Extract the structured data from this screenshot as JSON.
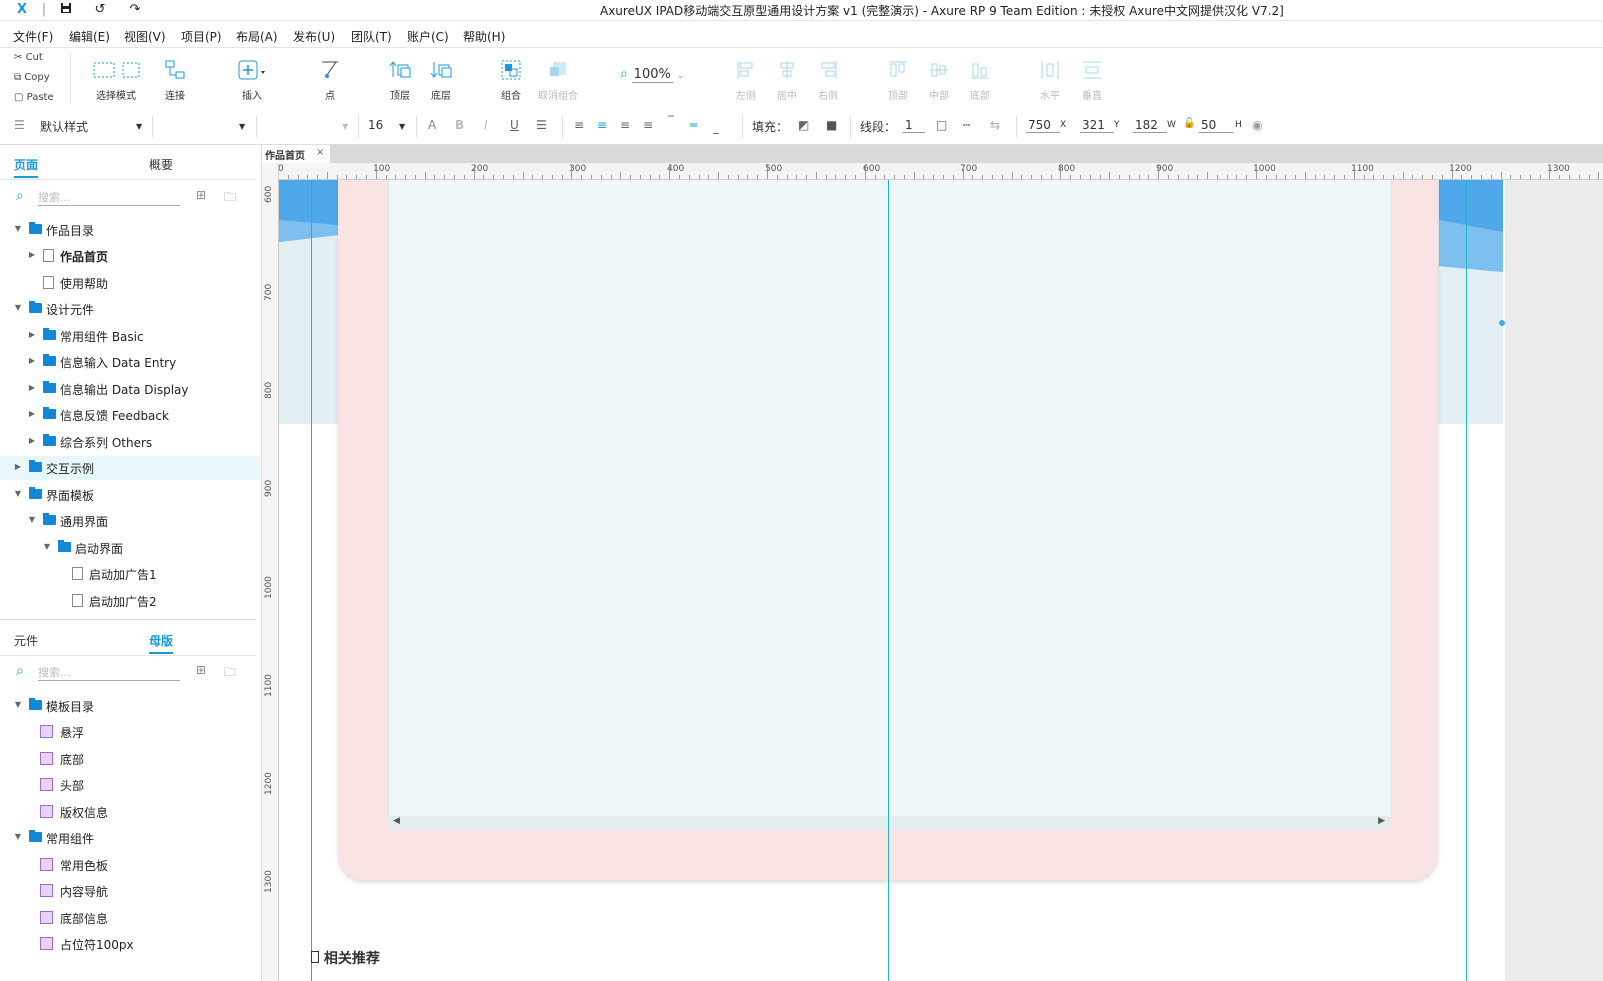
{
  "app": {
    "title": "AxureUX IPAD移动端交互原型通用设计方案 v1 (完整演示) - Axure RP 9 Team Edition : 未授权     Axure中文网提供汉化 V7.2]"
  },
  "menu": [
    "文件(F)",
    "编辑(E)",
    "视图(V)",
    "项目(P)",
    "布局(A)",
    "发布(U)",
    "团队(T)",
    "账户(C)",
    "帮助(H)"
  ],
  "clipboard": {
    "cut": "Cut",
    "copy": "Copy",
    "paste": "Paste"
  },
  "toolbar": {
    "select_mode": "选择模式",
    "connect": "连接",
    "insert": "插入",
    "point": "点",
    "top_layer": "顶层",
    "bottom_layer": "底层",
    "group": "组合",
    "ungroup": "取消组合",
    "zoom": "100%",
    "align_left": "左侧",
    "align_center": "居中",
    "align_right": "右侧",
    "align_top": "顶部",
    "align_middle": "中部",
    "align_bottom": "底部",
    "dist_horizontal": "水平",
    "dist_vertical": "垂直"
  },
  "format": {
    "style": "默认样式",
    "font_size": "16",
    "fill_label": "填充：",
    "line_label": "线段：",
    "line_value": "1",
    "x": "750",
    "x_label": "X",
    "y": "321",
    "y_label": "Y",
    "w": "182",
    "w_label": "W",
    "h": "50",
    "h_label": "H"
  },
  "pages_panel": {
    "tab_pages": "页面",
    "tab_outline": "概要",
    "search_placeholder": "搜索...",
    "items": [
      {
        "label": "作品目录"
      },
      {
        "label": "作品首页"
      },
      {
        "label": "使用帮助"
      },
      {
        "label": "设计元件"
      },
      {
        "label": "常用组件 Basic"
      },
      {
        "label": "信息输入 Data Entry"
      },
      {
        "label": "信息输出 Data Display"
      },
      {
        "label": "信息反馈 Feedback"
      },
      {
        "label": "综合系列 Others"
      },
      {
        "label": "交互示例"
      },
      {
        "label": "界面模板"
      },
      {
        "label": "通用界面"
      },
      {
        "label": "启动界面"
      },
      {
        "label": "启动加广告1"
      },
      {
        "label": "启动加广告2"
      }
    ]
  },
  "masters_panel": {
    "tab_widgets": "元件",
    "tab_masters": "母版",
    "search_placeholder": "搜索...",
    "items": [
      {
        "label": "模板目录"
      },
      {
        "label": "悬浮"
      },
      {
        "label": "底部"
      },
      {
        "label": "头部"
      },
      {
        "label": "版权信息"
      },
      {
        "label": "常用组件"
      },
      {
        "label": "常用色板"
      },
      {
        "label": "内容导航"
      },
      {
        "label": "底部信息"
      },
      {
        "label": "占位符100px"
      }
    ]
  },
  "document": {
    "tab_label": "作品首页",
    "close": "×",
    "h_ruler": [
      "0",
      "100",
      "200",
      "300",
      "400",
      "500",
      "600",
      "700",
      "800",
      "900",
      "1000",
      "1100",
      "1200",
      "1300"
    ],
    "v_ruler": [
      "600",
      "700",
      "800",
      "900",
      "1000",
      "1100",
      "1200",
      "1300"
    ],
    "bottom_text": "相关推荐"
  },
  "colors": {
    "accent": "#1a9bd7",
    "folder": "#1486d6",
    "guide": "#1fb3c4",
    "device_frame": "#f9e3e3",
    "screen": "#eef6f7"
  }
}
